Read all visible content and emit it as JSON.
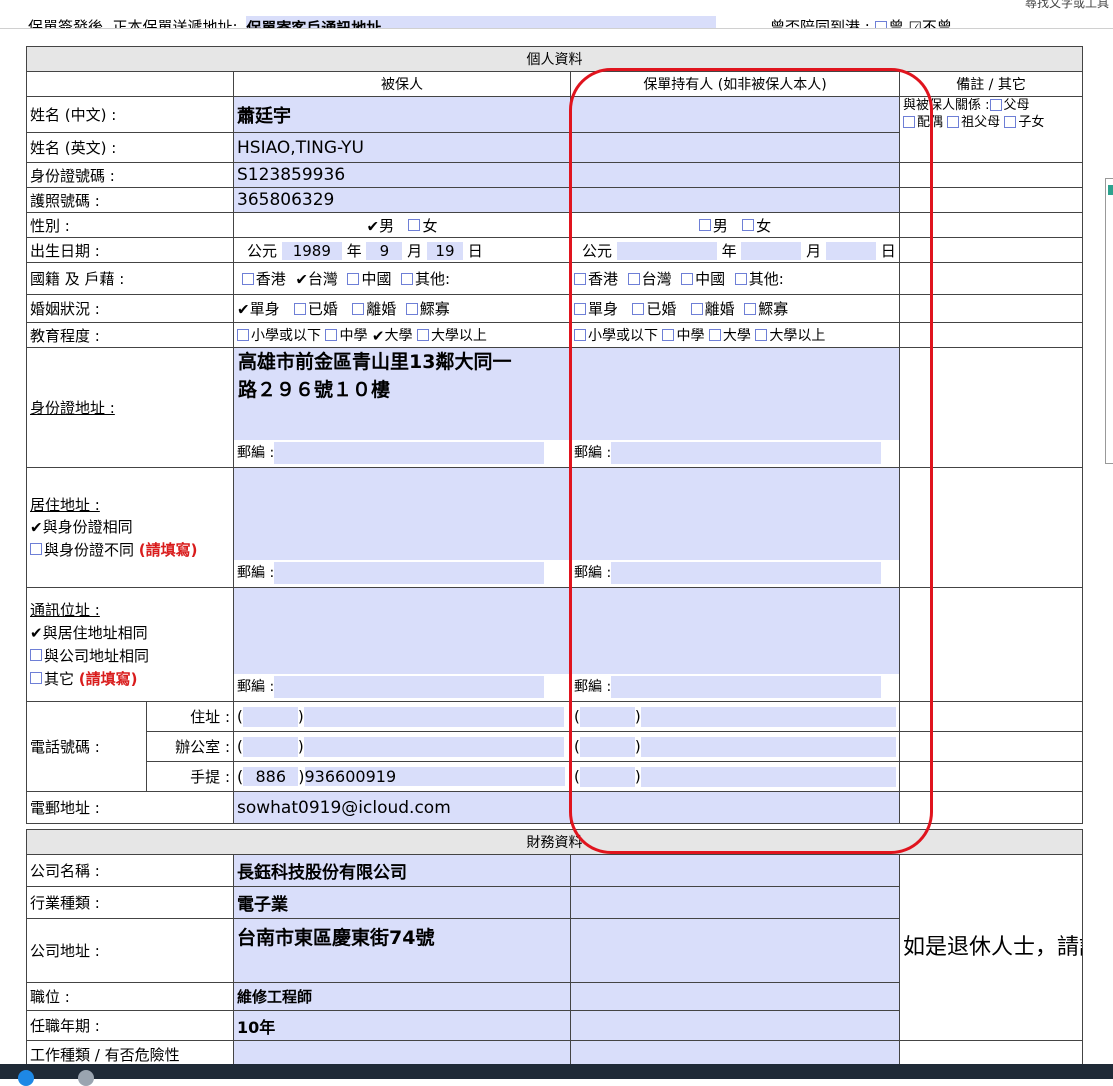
{
  "top": {
    "line1_label": "保單簽發後, 正本保單送遞地址:",
    "line1_value": "保單寄客戶通訊地址",
    "line2_label": "曾否陪同到港 :",
    "opt_yes": "曾",
    "opt_no": "不曾",
    "corner": "尋找文字或工具"
  },
  "personal": {
    "section_title": "個人資料",
    "col_insured": "被保人",
    "col_holder": "保單持有人 (如非被保人本人)",
    "col_remarks": "備註 / 其它",
    "rows": {
      "name_cn": {
        "label": "姓名 (中文) :",
        "insured": "蕭廷宇"
      },
      "name_en": {
        "label": "姓名 (英文) :",
        "insured": "HSIAO,TING-YU"
      },
      "id": {
        "label": "身份證號碼 :",
        "insured": "S123859936"
      },
      "passport": {
        "label": "護照號碼 :",
        "insured": "365806329"
      },
      "gender": {
        "label": "性別 :",
        "male": "男",
        "female": "女"
      },
      "dob": {
        "label": "出生日期 :",
        "era": "公元",
        "year": "1989",
        "month": "9",
        "day": "19",
        "y": "年",
        "m": "月",
        "d": "日"
      },
      "nationality": {
        "label": "國籍 及 戶藉 :",
        "opt1": "香港",
        "opt2": "台灣",
        "opt3": "中國",
        "opt4": "其他:"
      },
      "marital": {
        "label": "婚姻狀況 :",
        "opt1": "單身",
        "opt2": "已婚",
        "opt3": "離婚",
        "opt4": "鰥寡"
      },
      "education": {
        "label": "教育程度 :",
        "opt1": "小學或以下",
        "opt2": "中學",
        "opt3": "大學",
        "opt4": "大學以上"
      },
      "id_address": {
        "label": "身份證地址 :",
        "insured_line1": "高雄市前金區青山里13鄰大同一",
        "insured_line2": "路２９６號１０樓",
        "zip": "郵編 :"
      },
      "res_address": {
        "label": "居住地址 :",
        "opt_same": "與身份證相同",
        "opt_diff": "與身份證不同",
        "fill": "(請填寫)",
        "zip": "郵編 :"
      },
      "mail_address": {
        "label": "通訊位址 :",
        "opt1": "與居住地址相同",
        "opt2": "與公司地址相同",
        "opt3": "其它",
        "fill": "(請填寫)",
        "zip": "郵編 :"
      },
      "phone": {
        "label": "電話號碼 :",
        "home": "住址 :",
        "office": "辦公室 :",
        "mobile": "手提 :",
        "mobile_code": "886",
        "mobile_number": "936600919"
      },
      "email": {
        "label": "電郵地址 :",
        "insured": "sowhat0919@icloud.com"
      }
    },
    "remarks": {
      "relation": "與被保人關係 :",
      "opt1": "父母",
      "opt2": "配偶",
      "opt3": "祖父母",
      "opt4": "子女"
    }
  },
  "financial": {
    "section_title": "財務資料",
    "company_label": "公司名稱 :",
    "company": "長鈺科技股份有限公司",
    "industry_label": "行業種類 :",
    "industry": "電子業",
    "company_addr_label": "公司地址 :",
    "company_addr": "台南市東區慶東街74號",
    "position_label": "職位 :",
    "position": "維修工程師",
    "years_label": "任職年期 :",
    "years": "10年",
    "partial_label": "工作種類 / 有否危險性",
    "note": "如是退休人士，請說明退休多久，退休前所從事之職位及職務。"
  }
}
